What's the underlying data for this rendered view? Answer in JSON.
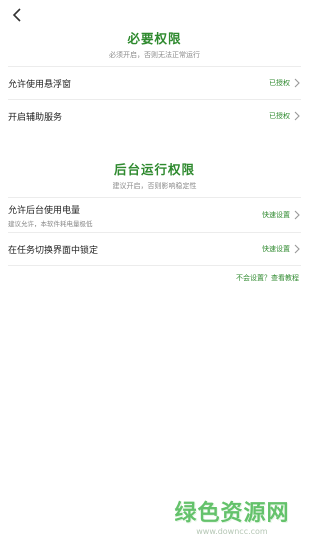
{
  "nav": {
    "back_icon": "back-chevron-icon"
  },
  "required": {
    "title": "必要权限",
    "subtitle": "必须开启，否则无法正常运行",
    "items": [
      {
        "label": "允许使用悬浮窗",
        "status": "已授权"
      },
      {
        "label": "开启辅助服务",
        "status": "已授权"
      }
    ]
  },
  "background": {
    "title": "后台运行权限",
    "subtitle": "建议开启，否则影响稳定性",
    "items": [
      {
        "label": "允许后台使用电量",
        "desc": "建议允许，本软件耗电量极低",
        "status": "快速设置"
      },
      {
        "label": "在任务切换界面中锁定",
        "status": "快速设置"
      }
    ]
  },
  "tutorial_link": "不会设置？查看教程",
  "watermark": {
    "text": "绿色资源网",
    "url": "www.downcc.com"
  },
  "colors": {
    "accent": "#2f8a2f",
    "watermark": "#64c26b"
  }
}
